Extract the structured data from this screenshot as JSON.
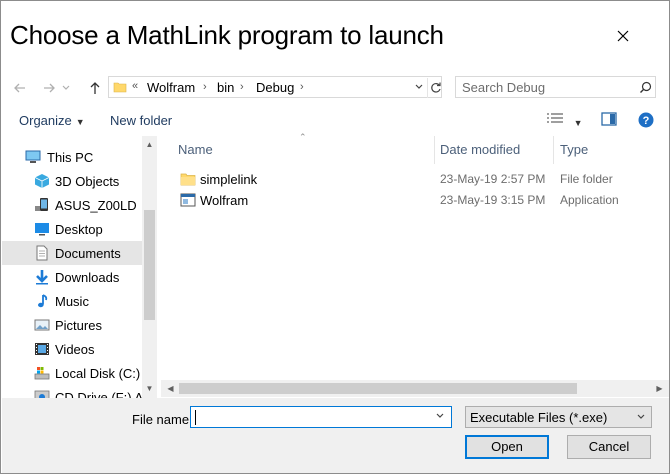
{
  "dialog": {
    "title": "Choose a MathLink program to launch"
  },
  "address": {
    "overflow": "«",
    "crumbs": [
      "Wolfram",
      "bin",
      "Debug"
    ]
  },
  "search": {
    "placeholder": "Search Debug"
  },
  "toolbar": {
    "organize": "Organize",
    "new_folder": "New folder"
  },
  "sidebar": {
    "items": [
      {
        "label": "This PC",
        "icon": "pc-icon"
      },
      {
        "label": "3D Objects",
        "icon": "3d-objects-icon"
      },
      {
        "label": "ASUS_Z00LD",
        "icon": "phone-icon"
      },
      {
        "label": "Desktop",
        "icon": "desktop-icon"
      },
      {
        "label": "Documents",
        "icon": "documents-icon",
        "selected": true
      },
      {
        "label": "Downloads",
        "icon": "downloads-icon"
      },
      {
        "label": "Music",
        "icon": "music-icon"
      },
      {
        "label": "Pictures",
        "icon": "pictures-icon"
      },
      {
        "label": "Videos",
        "icon": "videos-icon"
      },
      {
        "label": "Local Disk (C:)",
        "icon": "disk-icon"
      },
      {
        "label": "CD Drive (F:) ASU",
        "icon": "cd-drive-icon"
      }
    ]
  },
  "files": {
    "columns": {
      "name": "Name",
      "date": "Date modified",
      "type": "Type"
    },
    "rows": [
      {
        "name": "simplelink",
        "date": "23-May-19 2:57 PM",
        "type": "File folder",
        "icon": "folder-icon"
      },
      {
        "name": "Wolfram",
        "date": "23-May-19 3:15 PM",
        "type": "Application",
        "icon": "application-icon"
      }
    ]
  },
  "footer": {
    "file_name_label": "File name:",
    "file_name_value": "",
    "filter": "Executable Files (*.exe)",
    "open": "Open",
    "cancel": "Cancel"
  },
  "colors": {
    "accent": "#0078d7",
    "selected_bg": "#e5e5e5",
    "folder": "#ffd86b"
  }
}
